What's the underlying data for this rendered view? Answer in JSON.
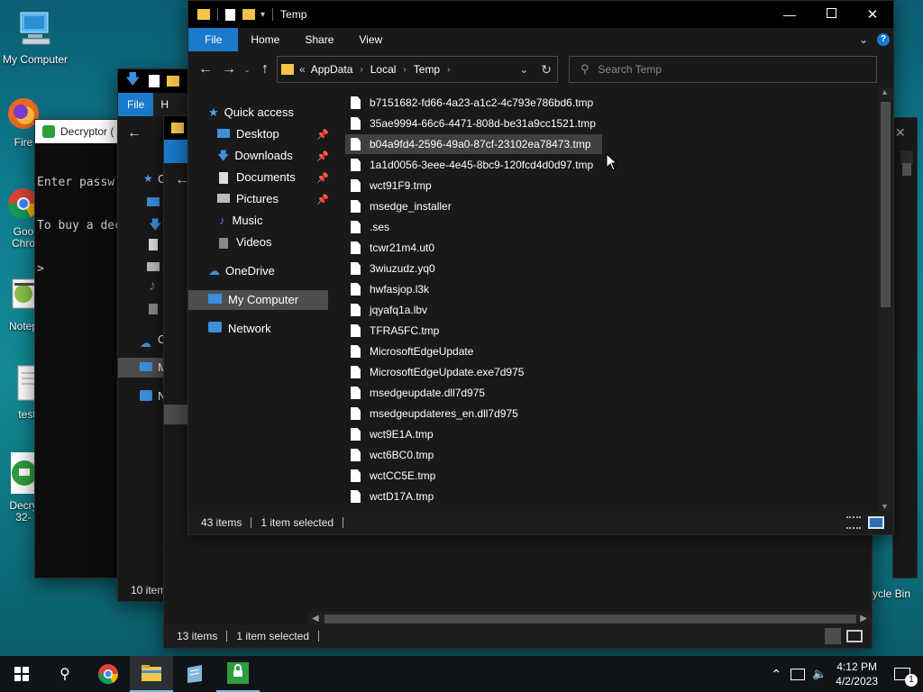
{
  "desktop": {
    "icons": [
      {
        "label": "My Computer"
      },
      {
        "label": "Fire"
      },
      {
        "label": "Goo Chro"
      },
      {
        "label": "Notep"
      },
      {
        "label": "test"
      },
      {
        "label": "Decry 32-"
      },
      {
        "label": "cycle Bin"
      }
    ]
  },
  "decryptor_window": {
    "title": "Decryptor (",
    "console_lines": [
      "Enter passw",
      "To buy a dec",
      ">"
    ]
  },
  "back_explorer": {
    "nav_text": [
      "C",
      "O",
      "M",
      "N"
    ],
    "tabs": {
      "file": "File",
      "home": "H"
    },
    "status": "10 item"
  },
  "mid_explorer": {
    "status_items": "13 items",
    "status_selected": "1 item selected"
  },
  "main_explorer": {
    "title": "Temp",
    "tabs": [
      "File",
      "Home",
      "Share",
      "View"
    ],
    "breadcrumb": {
      "prefix": "«",
      "parts": [
        "AppData",
        "Local",
        "Temp"
      ]
    },
    "search_placeholder": "Search Temp",
    "nav": {
      "quick_access": "Quick access",
      "desktop": "Desktop",
      "downloads": "Downloads",
      "documents": "Documents",
      "pictures": "Pictures",
      "music": "Music",
      "videos": "Videos",
      "onedrive": "OneDrive",
      "my_computer": "My Computer",
      "network": "Network"
    },
    "files": [
      "b7151682-fd66-4a23-a1c2-4c793e786bd6.tmp",
      "35ae9994-66c6-4471-808d-be31a9cc1521.tmp",
      "b04a9fd4-2596-49a0-87cf-23102ea78473.tmp",
      "1a1d0056-3eee-4e45-8bc9-120fcd4d0d97.tmp",
      "wct91F9.tmp",
      "msedge_installer",
      ".ses",
      "tcwr21m4.ut0",
      "3wiuzudz.yq0",
      "hwfasjop.l3k",
      "jqyafq1a.lbv",
      "TFRA5FC.tmp",
      "MicrosoftEdgeUpdate",
      "MicrosoftEdgeUpdate.exe7d975",
      "msedgeupdate.dll7d975",
      "msedgeupdateres_en.dll7d975",
      "wct9E1A.tmp",
      "wct6BC0.tmp",
      "wctCC5E.tmp",
      "wctD17A.tmp"
    ],
    "selected_file": "b04a9fd4-2596-49a0-87cf-23102ea78473.tmp",
    "status_items": "43 items",
    "status_selected": "1 item selected"
  },
  "taskbar": {
    "time": "4:12 PM",
    "date": "4/2/2023",
    "notification_count": "1"
  },
  "colors": {
    "file_tab": "#1979ca",
    "window_bg": "#191919",
    "selection": "#404040"
  }
}
